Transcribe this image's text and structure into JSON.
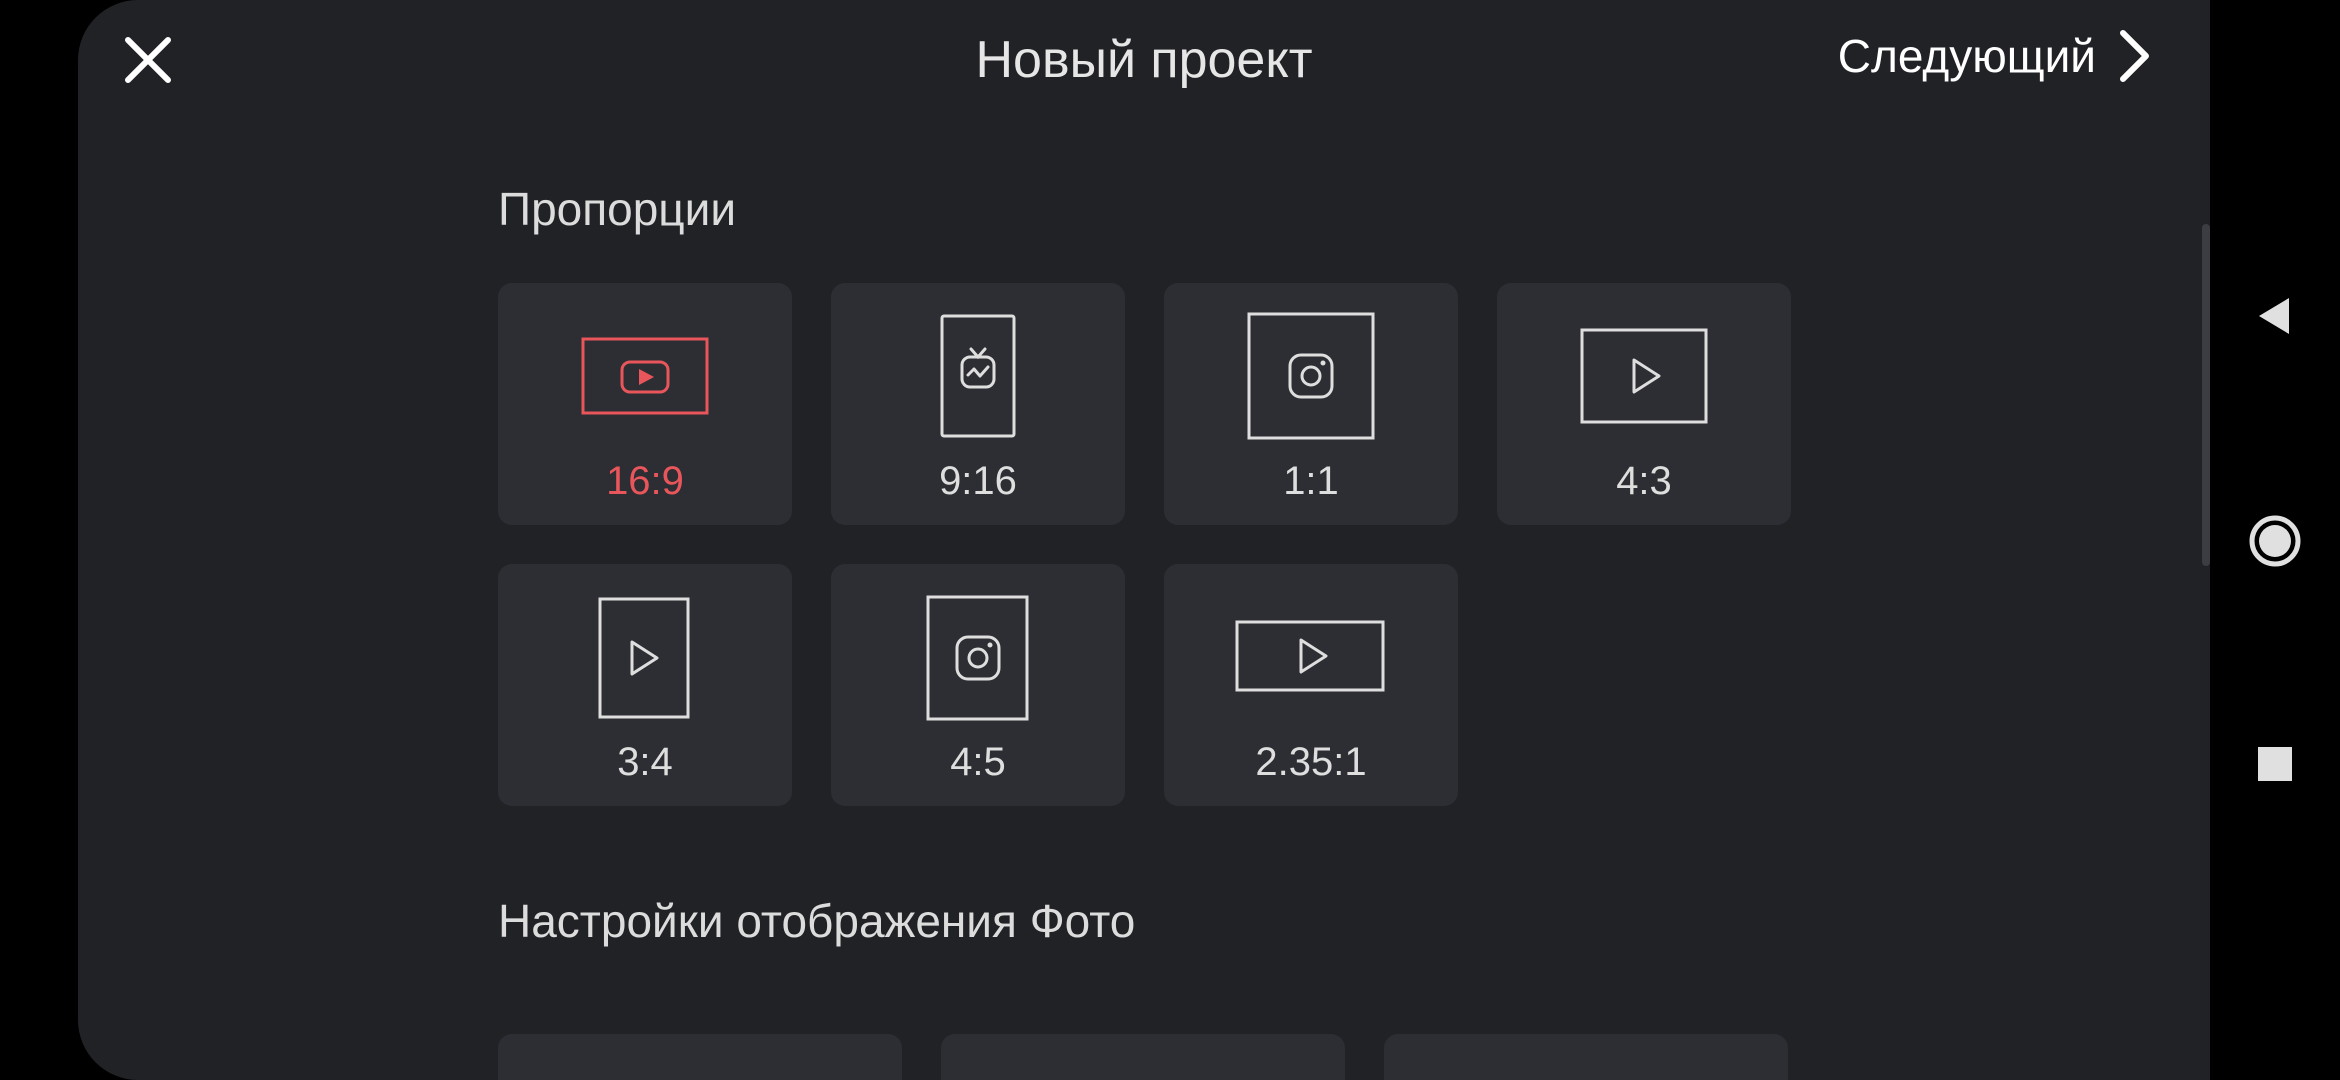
{
  "header": {
    "title": "Новый проект",
    "next_label": "Следующий",
    "close_icon": "close-icon",
    "next_icon": "chevron-right-icon"
  },
  "aspect_section": {
    "title": "Пропорции",
    "selected": "16:9",
    "accent_color": "#e8565b",
    "items": [
      {
        "label": "16:9",
        "icon": "youtube-icon"
      },
      {
        "label": "9:16",
        "icon": "igtv-icon"
      },
      {
        "label": "1:1",
        "icon": "instagram-icon"
      },
      {
        "label": "4:3",
        "icon": "play-icon"
      },
      {
        "label": "3:4",
        "icon": "play-icon"
      },
      {
        "label": "4:5",
        "icon": "instagram-icon"
      },
      {
        "label": "2.35:1",
        "icon": "play-icon"
      }
    ]
  },
  "photo_section": {
    "title": "Настройки отображения Фото"
  },
  "system_nav": {
    "back_icon": "back-triangle-icon",
    "home_icon": "home-circle-icon",
    "recents_icon": "recents-square-icon"
  }
}
